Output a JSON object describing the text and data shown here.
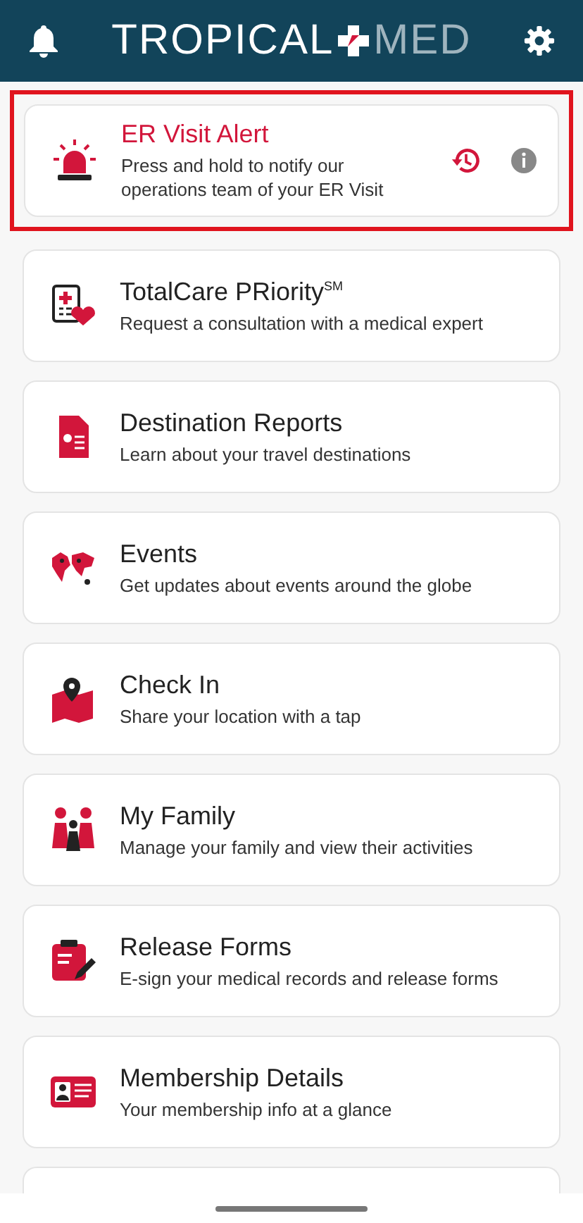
{
  "header": {
    "logo_left": "TROPICAL",
    "logo_right": "MED"
  },
  "alert": {
    "title": "ER Visit Alert",
    "subtitle": "Press and hold to notify our operations team of your ER Visit",
    "highlighted": true
  },
  "items": [
    {
      "kind": "totalcare",
      "title": "TotalCare PRiority$^{SM}$",
      "subtitle": "Request a consultation with a medical expert"
    },
    {
      "kind": "destination",
      "title": "Destination Reports",
      "subtitle": "Learn about your travel destinations"
    },
    {
      "kind": "events",
      "title": "Events",
      "subtitle": "Get updates about events around the globe"
    },
    {
      "kind": "checkin",
      "title": "Check In",
      "subtitle": "Share your location with a tap"
    },
    {
      "kind": "family",
      "title": "My Family",
      "subtitle": "Manage your family and view their activities"
    },
    {
      "kind": "forms",
      "title": "Release Forms",
      "subtitle": "E-sign your medical records and release forms"
    },
    {
      "kind": "membership",
      "title": "Membership Details",
      "subtitle": "Your membership info at a glance"
    },
    {
      "kind": "travel"
    }
  ]
}
